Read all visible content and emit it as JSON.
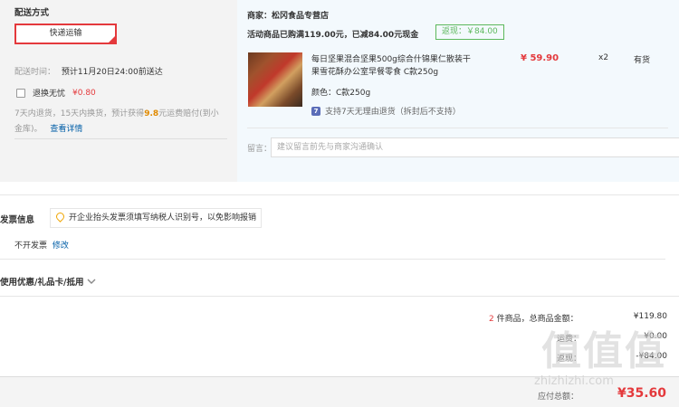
{
  "shipping": {
    "title": "配送方式",
    "method": "快递运输",
    "time_label": "配送时间：",
    "time_value": "预计11月20日24:00前送达",
    "insurance_label": "退换无忧",
    "insurance_price": "¥0.80",
    "desc_1": "7天内退货，15天内换货，预计获得",
    "desc_amount": "9.8",
    "desc_2": "元运费赔付(到小",
    "desc_3": "金库)。",
    "details_link": "查看详情"
  },
  "merchant": {
    "label": "商家：",
    "name": "松冈食品专营店",
    "promo": "活动商品已购满119.00元，已减84.00元现金",
    "rebate": "返现：￥84.00"
  },
  "product": {
    "title_line1": "每日坚果混合坚果500g综合什锦果仁散装干",
    "title_line2": "果雪花酥办公室早餐零食 C款250g",
    "price": "¥ 59.90",
    "qty": "x2",
    "stock": "有货",
    "color_label": "颜色：",
    "color_value": "C款250g",
    "return_icon": "7",
    "return_policy": "支持7天无理由退货（拆封后不支持）"
  },
  "remark": {
    "label": "留言：",
    "placeholder": "建议留言前先与商家沟通确认"
  },
  "invoice": {
    "title": "发票信息",
    "tip": "开企业抬头发票须填写纳税人识别号，以免影响报销",
    "value": "不开发票",
    "edit": "修改"
  },
  "coupons": {
    "title": "使用优惠/礼品卡/抵用"
  },
  "summary": {
    "count": "2",
    "count_text": "件商品，总商品金额：",
    "total": "¥119.80",
    "row2_label": "运费：",
    "row2_value": "¥0.00",
    "row3_label": "返现：",
    "row3_value": "-¥84.00",
    "pay_label": "应付总额：",
    "pay_value": "¥35.60"
  },
  "watermark": {
    "text": "值值值",
    "url": "zhizhizhi.com"
  },
  "colors": {
    "accent": "#e4393c",
    "link": "#005ea7",
    "rebate": "#5cb85c"
  }
}
